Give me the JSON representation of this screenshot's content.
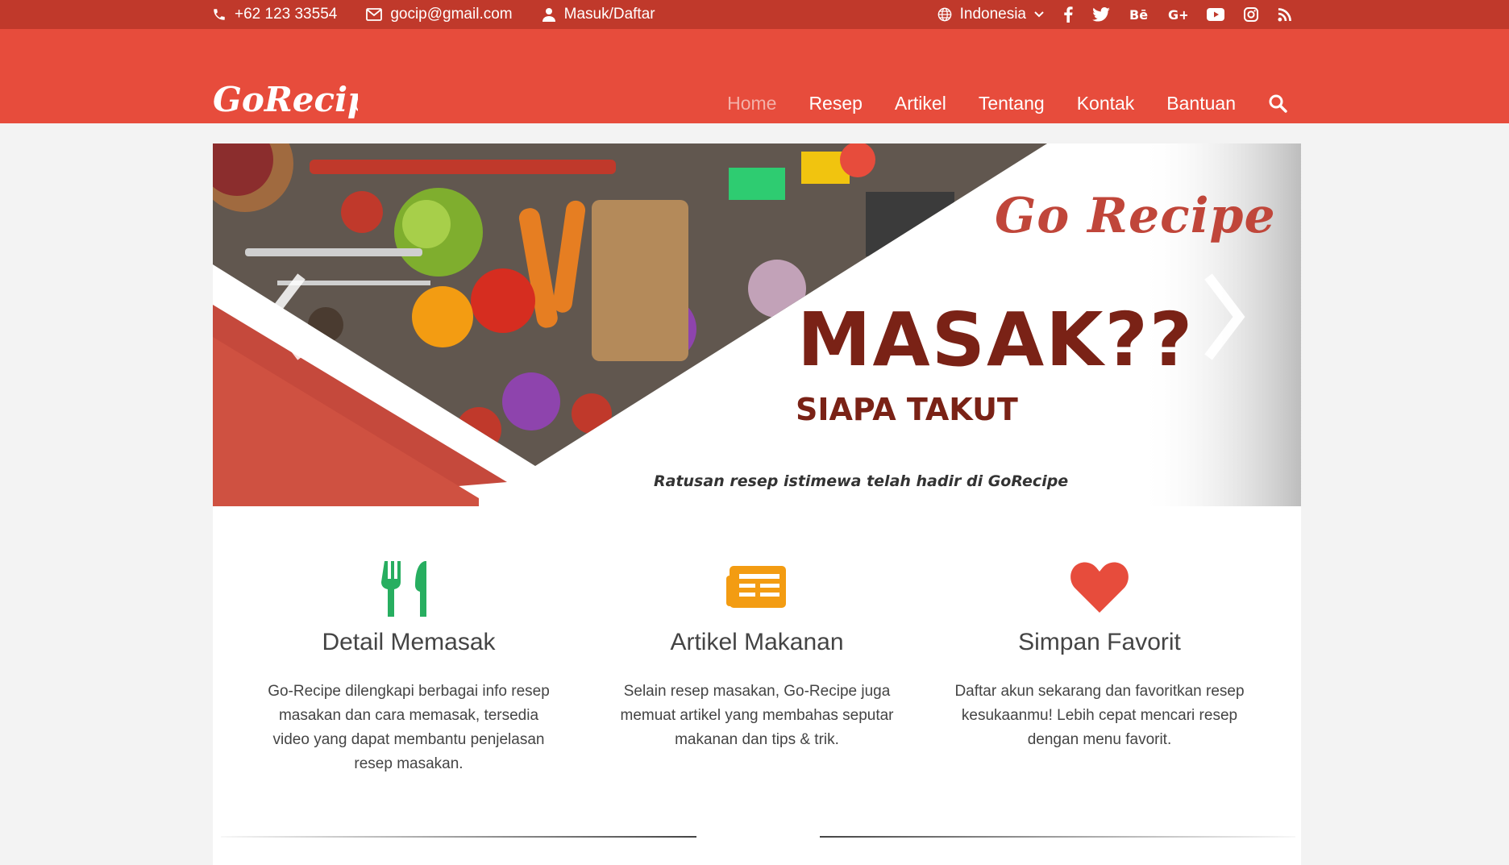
{
  "topbar": {
    "phone": "+62 123 33554",
    "email": "gocip@gmail.com",
    "login": "Masuk/Daftar",
    "language": "Indonesia",
    "social_icons": [
      "facebook-icon",
      "twitter-icon",
      "behance-icon",
      "google-plus-icon",
      "youtube-icon",
      "instagram-icon",
      "rss-icon"
    ]
  },
  "brand": {
    "logo_text": "GoRecipe"
  },
  "nav": {
    "items": [
      "Home",
      "Resep",
      "Artikel",
      "Tentang",
      "Kontak",
      "Bantuan"
    ],
    "active": "Home"
  },
  "slider": {
    "brand": "Go Recipe",
    "headline": "MASAK??",
    "subheadline": "SIAPA TAKUT",
    "caption": "Ratusan resep istimewa telah hadir di GoRecipe"
  },
  "features": [
    {
      "icon": "cutlery-icon",
      "title": "Detail Memasak",
      "text": "Go-Recipe dilengkapi berbagai info resep masakan dan cara memasak, tersedia video yang dapat membantu penjelasan resep masakan."
    },
    {
      "icon": "newspaper-icon",
      "title": "Artikel Makanan",
      "text": "Selain resep masakan, Go-Recipe juga memuat artikel yang membahas seputar makanan dan tips & trik."
    },
    {
      "icon": "heart-icon",
      "title": "Simpan Favorit",
      "text": "Daftar akun sekarang dan favoritkan resep kesukaanmu! Lebih cepat mencari resep dengan menu favorit."
    }
  ],
  "colors": {
    "topbar": "#c0392b",
    "navbar": "#e74c3c",
    "fork": "#27ae60",
    "newspaper": "#f39c12",
    "heart": "#e74c3c"
  }
}
